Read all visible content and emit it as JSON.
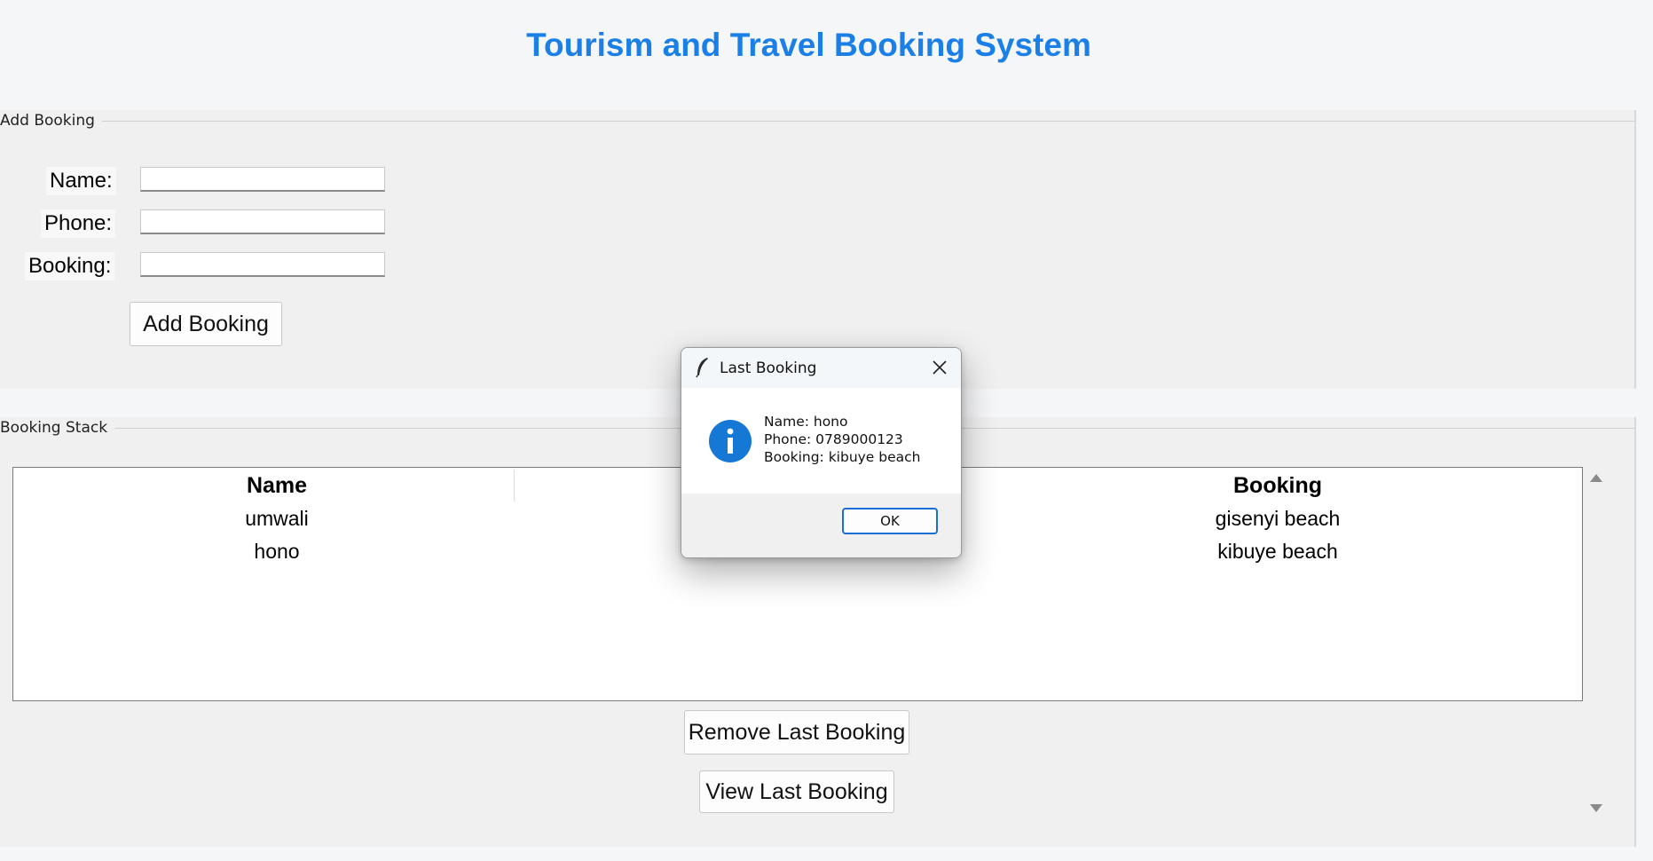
{
  "app": {
    "title": "Tourism and Travel Booking System"
  },
  "add_booking": {
    "legend": "Add Booking",
    "fields": {
      "name_label": "Name:",
      "phone_label": "Phone:",
      "booking_label": "Booking:",
      "name_value": "",
      "phone_value": "",
      "booking_value": ""
    },
    "add_button": "Add Booking"
  },
  "booking_stack": {
    "legend": "Booking Stack",
    "columns": [
      "Name",
      "",
      "Booking"
    ],
    "rows": [
      {
        "name": "umwali",
        "phone": "",
        "booking": "gisenyi beach"
      },
      {
        "name": "hono",
        "phone": "",
        "booking": "kibuye beach"
      }
    ],
    "remove_button": "Remove Last Booking",
    "view_button": "View Last Booking"
  },
  "dialog": {
    "title": "Last Booking",
    "icon": "info-icon",
    "lines": [
      "Name: hono",
      "Phone: 0789000123",
      "Booking: kibuye beach"
    ],
    "ok_button": "OK"
  },
  "colors": {
    "title": "#1a7fe6",
    "dialog_ok_border": "#1a6fd6",
    "info_icon": "#1478d4"
  }
}
